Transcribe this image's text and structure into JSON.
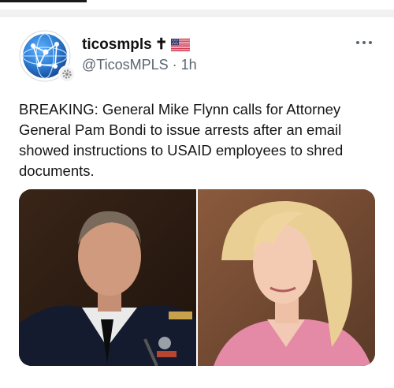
{
  "post": {
    "display_name": "ticosmpls",
    "name_suffix": "✝",
    "handle": "@TicosMPLS",
    "separator": "·",
    "time": "1h",
    "text": "BREAKING: General Mike Flynn calls for Attorney General Pam Bondi to issue arrests after an email showed instructions to USAID employees to shred documents."
  },
  "icons": {
    "avatar": "globe-network-icon",
    "badge": "gear-icon",
    "flag": "us-flag-icon",
    "more": "more-options-icon"
  },
  "colors": {
    "avatar_blue": "#2f7fd6",
    "muted_text": "#5b6670",
    "text": "#161616"
  }
}
